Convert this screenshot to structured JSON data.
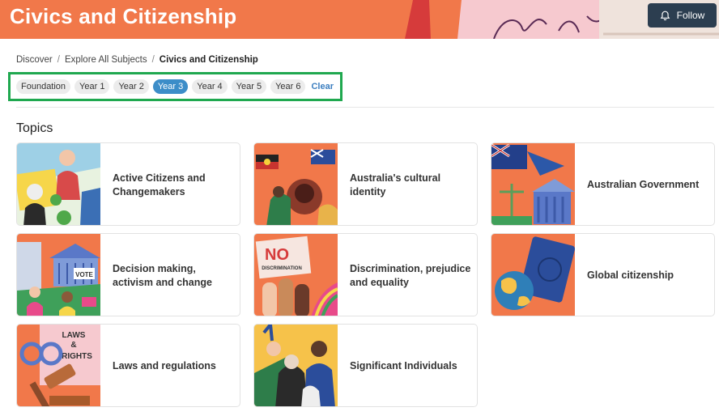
{
  "header": {
    "title": "Civics and Citizenship",
    "follow_label": "Follow"
  },
  "breadcrumb": {
    "items": [
      "Discover",
      "Explore All Subjects"
    ],
    "current": "Civics and Citizenship"
  },
  "filters": {
    "years": [
      "Foundation",
      "Year 1",
      "Year 2",
      "Year 3",
      "Year 4",
      "Year 5",
      "Year 6"
    ],
    "selected": "Year 3",
    "clear_label": "Clear"
  },
  "topics": {
    "heading": "Topics",
    "cards": [
      {
        "label": "Active Citizens and Changemakers",
        "icon": "activists-illustration"
      },
      {
        "label": "Australia's cultural identity",
        "icon": "flags-illustration"
      },
      {
        "label": "Australian Government",
        "icon": "parliament-illustration"
      },
      {
        "label": "Decision making, activism and change",
        "icon": "vote-illustration"
      },
      {
        "label": "Discrimination, prejudice and equality",
        "icon": "no-discrimination-illustration"
      },
      {
        "label": "Global citizenship",
        "icon": "globe-passport-illustration"
      },
      {
        "label": "Laws and regulations",
        "icon": "gavel-illustration"
      },
      {
        "label": "Significant Individuals",
        "icon": "portraits-illustration"
      }
    ],
    "thumb_text": {
      "no": "NO",
      "discrimination": "DISCRIMINATION",
      "laws": "LAWS",
      "amp": "&",
      "rights": "RIGHTS",
      "vote": "VOTE"
    }
  },
  "colors": {
    "banner": "#f1784a",
    "accent": "#3c8dc8",
    "highlight_box": "#1fa84f"
  }
}
